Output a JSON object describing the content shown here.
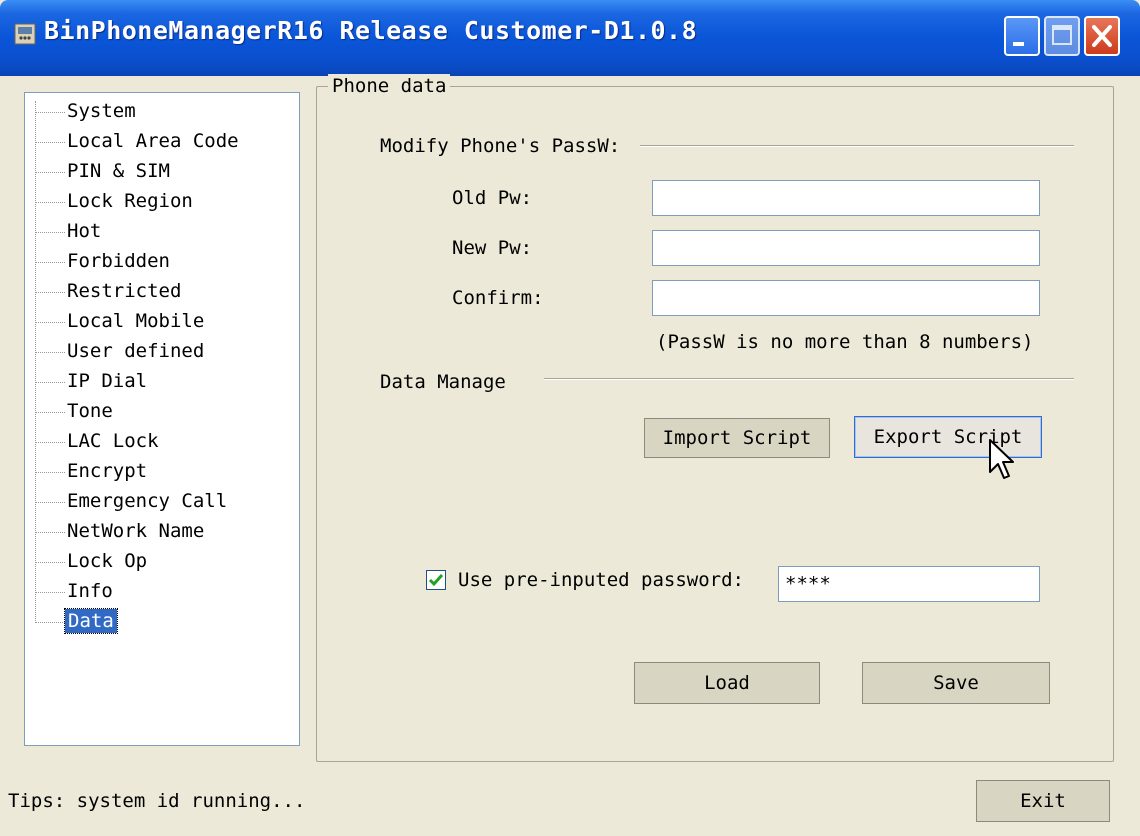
{
  "window": {
    "title": "BinPhoneManagerR16 Release Customer-D1.0.8"
  },
  "tree": {
    "items": [
      "System",
      "Local Area Code",
      "PIN & SIM",
      "Lock Region",
      "Hot",
      "Forbidden",
      "Restricted",
      "Local Mobile",
      "User defined",
      "IP Dial",
      "Tone",
      "LAC Lock",
      "Encrypt",
      "Emergency Call",
      "NetWork Name",
      "Lock Op",
      "Info",
      "Data"
    ],
    "selected": "Data"
  },
  "panel": {
    "title": "Phone data",
    "password_section": {
      "heading": "Modify Phone's PassW:",
      "old_label": "Old Pw:",
      "new_label": "New Pw:",
      "confirm_label": "Confirm:",
      "old_value": "",
      "new_value": "",
      "confirm_value": "",
      "hint": "(PassW is no more than 8 numbers)"
    },
    "data_section": {
      "heading": "Data Manage",
      "import_label": "Import Script",
      "export_label": "Export Script"
    },
    "preinput": {
      "checked": true,
      "label": "Use pre-inputed password:",
      "value": "****"
    },
    "load_label": "Load",
    "save_label": "Save"
  },
  "footer": {
    "tips": "Tips: system id running...",
    "exit_label": "Exit"
  }
}
